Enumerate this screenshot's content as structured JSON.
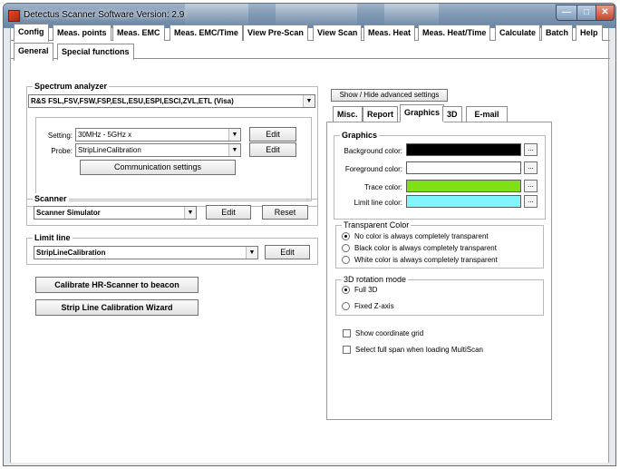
{
  "window": {
    "title": "Detectus Scanner Software Version: 2.9"
  },
  "main_tabs": [
    {
      "label": "Config"
    },
    {
      "label": "Meas. points"
    },
    {
      "label": "Meas. EMC"
    },
    {
      "label": "Meas. EMC/Time"
    },
    {
      "label": "View Pre-Scan"
    },
    {
      "label": "View Scan"
    },
    {
      "label": "Meas. Heat"
    },
    {
      "label": "Meas. Heat/Time"
    },
    {
      "label": "Calculate"
    },
    {
      "label": "Batch"
    },
    {
      "label": "Help"
    }
  ],
  "sub_tabs": [
    {
      "label": "General"
    },
    {
      "label": "Special functions"
    }
  ],
  "spectrum": {
    "title": "Spectrum analyzer",
    "device": "R&S FSL,FSV,FSW,FSP,ESL,ESU,ESPI,ESCI,ZVL,ETL (Visa)",
    "setting_label": "Setting:",
    "setting_value": "30MHz - 5GHz x",
    "probe_label": "Probe:",
    "probe_value": "StripLineCalibration",
    "edit_label": "Edit",
    "comm_button": "Communication settings"
  },
  "scanner": {
    "title": "Scanner",
    "value": "Scanner Simulator",
    "edit_label": "Edit",
    "reset_label": "Reset"
  },
  "limit": {
    "title": "Limit line",
    "value": "StripLineCalibration",
    "edit_label": "Edit"
  },
  "calibrate_button": "Calibrate HR-Scanner to beacon",
  "wizard_button": "Strip Line Calibration Wizard",
  "advanced_button": "Show / Hide advanced settings",
  "settings_tabs": [
    {
      "label": "Misc."
    },
    {
      "label": "Report"
    },
    {
      "label": "Graphics"
    },
    {
      "label": "3D"
    },
    {
      "label": "E-mail"
    }
  ],
  "graphics": {
    "title": "Graphics",
    "dots_label": "...",
    "rows": [
      {
        "label": "Background color:",
        "color": "#000000"
      },
      {
        "label": "Foreground color:",
        "color": "#ffffff"
      },
      {
        "label": "Trace color:",
        "color": "#7fe016"
      },
      {
        "label": "Limit line color:",
        "color": "#7ff6ff"
      }
    ]
  },
  "transparent": {
    "title": "Transparent Color",
    "options": [
      {
        "label": "No color is always completely transparent",
        "selected": true
      },
      {
        "label": "Black color is always completely transparent",
        "selected": false
      },
      {
        "label": "White color is always completely transparent",
        "selected": false
      }
    ]
  },
  "rotation": {
    "title": "3D rotation mode",
    "options": [
      {
        "label": "Full 3D",
        "selected": true
      },
      {
        "label": "Fixed Z-axis",
        "selected": false
      }
    ]
  },
  "checkboxes": [
    {
      "label": "Show coordinate grid",
      "checked": false
    },
    {
      "label": "Select full span when loading MultiScan",
      "checked": false
    }
  ]
}
